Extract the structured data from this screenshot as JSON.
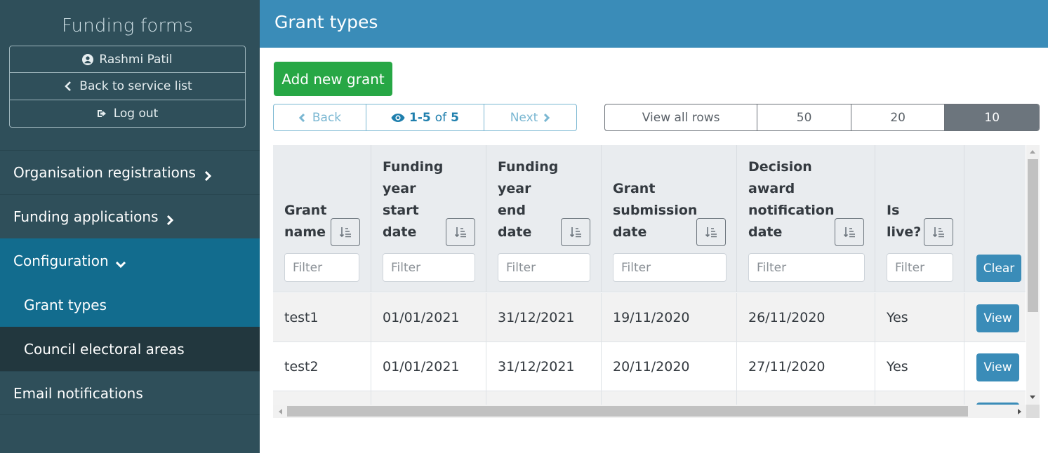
{
  "sidebar": {
    "title": "Funding forms",
    "user_name": "Rashmi Patil",
    "back_label": "Back to service list",
    "logout_label": "Log out",
    "nav": {
      "org": "Organisation registrations",
      "funding": "Funding applications",
      "config": "Configuration",
      "grant_types": "Grant types",
      "council": "Council electoral areas",
      "email": "Email notifications"
    }
  },
  "header": {
    "title": "Grant types"
  },
  "toolbar": {
    "add_label": "Add new grant",
    "pager": {
      "back": "Back",
      "range": "1-5",
      "of": "of",
      "total": "5",
      "next": "Next"
    },
    "rows": {
      "all": "View all rows",
      "r50": "50",
      "r20": "20",
      "r10": "10",
      "selected": "10"
    }
  },
  "table": {
    "headers": {
      "name": "Grant\nname",
      "start": "Funding\nyear\nstart\ndate",
      "end": "Funding\nyear\nend\ndate",
      "submission": "Grant\nsubmission\ndate",
      "decision": "Decision\naward\nnotification\ndate",
      "live": "Is\nlive?"
    },
    "filter_placeholder": "Filter",
    "clear_label": "Clear",
    "view_label": "View",
    "rows": [
      {
        "name": "test1",
        "start": "01/01/2021",
        "end": "31/12/2021",
        "submission": "19/11/2020",
        "decision": "26/11/2020",
        "live": "Yes"
      },
      {
        "name": "test2",
        "start": "01/01/2021",
        "end": "31/12/2021",
        "submission": "20/11/2020",
        "decision": "27/11/2020",
        "live": "Yes"
      }
    ]
  },
  "colors": {
    "sidebar": "#2f4f5a",
    "active": "#126c8e",
    "header": "#3a8cb8",
    "success": "#27a745"
  }
}
